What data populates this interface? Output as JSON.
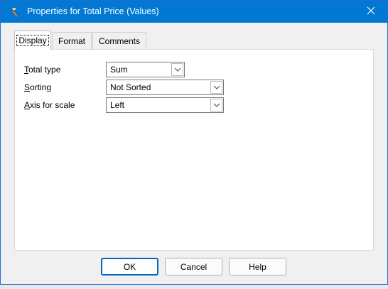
{
  "window": {
    "title": "Properties for Total Price (Values)",
    "icon": "hammer-icon",
    "close_icon": "close-icon",
    "accent": "#0078d4"
  },
  "tabs": [
    {
      "label": "Display",
      "active": true
    },
    {
      "label": "Format",
      "active": false
    },
    {
      "label": "Comments",
      "active": false
    }
  ],
  "fields": [
    {
      "label_first": "T",
      "label_rest": "otal type",
      "value": "Sum"
    },
    {
      "label_first": "S",
      "label_rest": "orting",
      "value": "Not Sorted"
    },
    {
      "label_first": "A",
      "label_rest": "xis for scale",
      "value": "Left"
    }
  ],
  "buttons": {
    "ok": "OK",
    "cancel": "Cancel",
    "help": "Help"
  }
}
